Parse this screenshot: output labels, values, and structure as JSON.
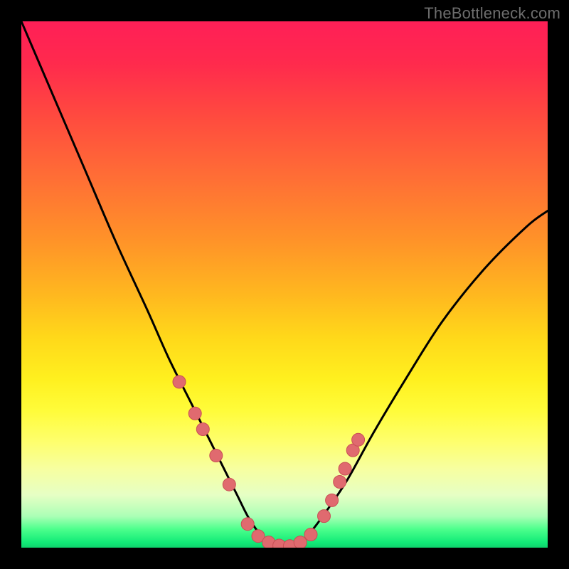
{
  "watermark": "TheBottleneck.com",
  "colors": {
    "frame": "#000000",
    "curve": "#000000",
    "marker_fill": "#e06a6f",
    "marker_stroke": "#c94f55",
    "gradient_stops": [
      {
        "pct": 0,
        "hex": "#ff1f57"
      },
      {
        "pct": 18,
        "hex": "#ff4a3f"
      },
      {
        "pct": 42,
        "hex": "#ff9428"
      },
      {
        "pct": 60,
        "hex": "#ffd81a"
      },
      {
        "pct": 74,
        "hex": "#fffc3a"
      },
      {
        "pct": 90,
        "hex": "#e6ffc4"
      },
      {
        "pct": 96,
        "hex": "#4cff8c"
      },
      {
        "pct": 100,
        "hex": "#0fd36d"
      }
    ]
  },
  "chart_data": {
    "type": "line",
    "title": "",
    "xlabel": "",
    "ylabel": "",
    "xlim": [
      0,
      100
    ],
    "ylim": [
      0,
      100
    ],
    "series": [
      {
        "name": "bottleneck-curve",
        "x": [
          0,
          6,
          12,
          18,
          24,
          28,
          32,
          35,
          38,
          41,
          43,
          45,
          47,
          50,
          53,
          55,
          58,
          62,
          67,
          73,
          80,
          88,
          96,
          100
        ],
        "y": [
          100,
          86,
          72,
          58,
          45,
          36,
          28,
          22,
          16,
          10,
          6,
          3,
          1,
          0,
          1,
          3,
          7,
          13,
          22,
          32,
          43,
          53,
          61,
          64
        ]
      }
    ],
    "markers": {
      "name": "highlight-dots",
      "x": [
        30.0,
        33.0,
        34.5,
        37.0,
        39.5,
        43.0,
        45.0,
        47.0,
        49.0,
        51.0,
        53.0,
        55.0,
        57.5,
        59.0,
        60.5,
        61.5,
        63.0,
        64.0
      ],
      "y": [
        31.5,
        25.5,
        22.5,
        17.5,
        12.0,
        4.5,
        2.2,
        1.0,
        0.4,
        0.3,
        1.0,
        2.5,
        6.0,
        9.0,
        12.5,
        15.0,
        18.5,
        20.5
      ]
    }
  }
}
